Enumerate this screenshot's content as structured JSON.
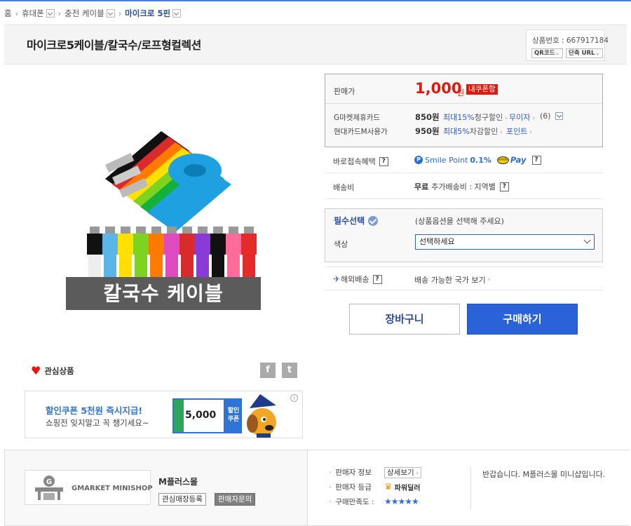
{
  "breadcrumb": {
    "items": [
      "홈",
      "휴대폰",
      "충전 케이블",
      "마이크로 5핀"
    ]
  },
  "product": {
    "title": "마이크로5케이블/칼국수/로프형컬렉션",
    "item_no": "상품번호 : 667917184",
    "qr_button": "QR코드",
    "short_url_button": "단축 URL",
    "image_caption": "칼국수 케이블"
  },
  "price": {
    "label": "판매가",
    "value": "1,000",
    "unit": "원",
    "coupon_badge": "내쿠폰함"
  },
  "cards": [
    {
      "name": "G마켓제휴카드",
      "price": "850원",
      "rate": "최대15%",
      "rate_suffix": "청구할인",
      "link": "무이자",
      "count": "(6)"
    },
    {
      "name": "현대카드M사용가",
      "price": "950원",
      "rate": "최대5%",
      "rate_suffix": "차감할인",
      "link": "포인트"
    }
  ],
  "benefit": {
    "label": "바로접속혜택",
    "smile_text": "Smile Point",
    "smile_rate": "0.1%",
    "pay_text": "Pay"
  },
  "shipping": {
    "label": "배송비",
    "free": "무료",
    "extra": "추가배송비 : 지역별"
  },
  "option": {
    "title": "필수선택",
    "hint": "(상품옵션을 선택해 주세요)",
    "color_label": "색상",
    "select_value": "선택하세요"
  },
  "overseas": {
    "label": "해외배송",
    "value": "배송 가능한 국가 보기"
  },
  "buttons": {
    "cart": "장바구니",
    "buy": "구매하기"
  },
  "wishlist": {
    "label": "관심상품"
  },
  "banner": {
    "headline": "할인쿠폰 5천원 즉시지급!",
    "sub": "쇼핑전 잊지말고 꼭 챙기세요~",
    "coupon_value": "5,000",
    "coupon_side": "할인쿠폰"
  },
  "seller": {
    "logo_text": "GMARKET MINISHOP",
    "shop_name": "M플러스몰",
    "fav_button": "관심매장등록",
    "ask_button": "판매자문의",
    "info_label": "판매자 정보",
    "detail_button": "상세보기",
    "grade_label": "판매자 등급",
    "grade_value": "파워딜러",
    "satisfaction_label": "구매만족도 :",
    "stars": "★★★★★",
    "greeting": "반갑습니다. M플러스몰 미니샵입니다."
  },
  "colors": {
    "accent_blue": "#2a62d8",
    "price_red": "#e3170b"
  }
}
